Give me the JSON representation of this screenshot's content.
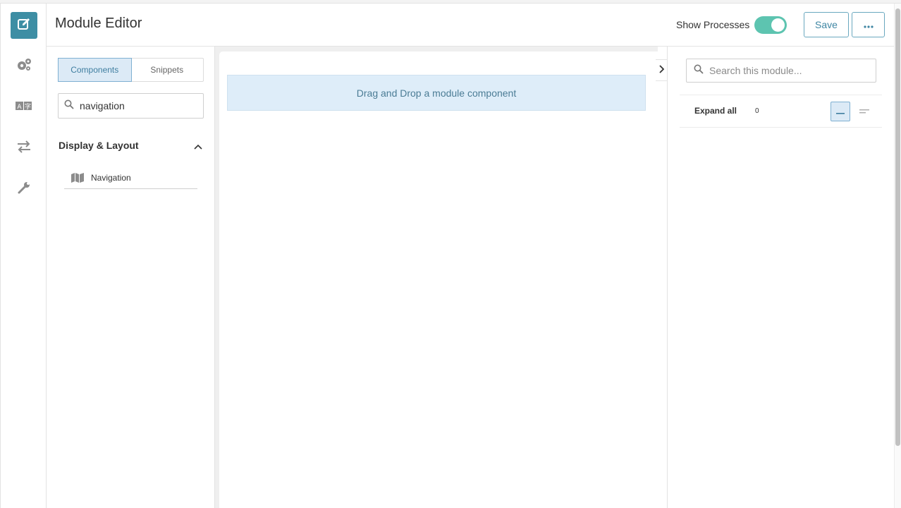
{
  "header": {
    "title": "Module Editor",
    "show_processes_label": "Show Processes",
    "show_processes_on": true,
    "save_label": "Save",
    "more_label": "•••"
  },
  "rail": {
    "items": [
      {
        "icon": "edit-icon",
        "active": true
      },
      {
        "icon": "gears-icon",
        "active": false
      },
      {
        "icon": "translate-icon",
        "active": false
      },
      {
        "icon": "transfer-icon",
        "active": false
      },
      {
        "icon": "wrench-icon",
        "active": false
      }
    ]
  },
  "left_panel": {
    "tabs": [
      {
        "label": "Components",
        "active": true
      },
      {
        "label": "Snippets",
        "active": false
      }
    ],
    "search_value": "navigation",
    "section_title": "Display & Layout",
    "items": [
      {
        "label": "Navigation",
        "icon": "map-icon"
      }
    ]
  },
  "canvas": {
    "drop_text": "Drag and Drop a module component"
  },
  "right_panel": {
    "search_placeholder": "Search this module...",
    "expand_label": "Expand all",
    "count": "0"
  },
  "colors": {
    "accent": "#3d8ea4",
    "toggle": "#5dc4b0",
    "drop_bg": "#deedf9",
    "active_seg_bg": "#dceaf6"
  }
}
